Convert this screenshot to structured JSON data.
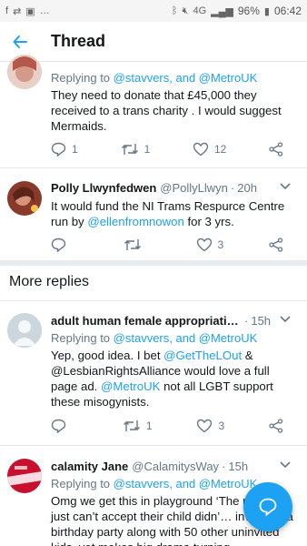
{
  "status_bar": {
    "battery": "96%",
    "time": "06:42",
    "network": "4G"
  },
  "header": {
    "title": "Thread"
  },
  "tweets": [
    {
      "reply_prefix": "Replying to ",
      "reply_targets": "@stavvers, and @MetroUK",
      "text": "They need to donate that £45,000 they received to a trans charity . I would suggest Mermaids.",
      "replies": "1",
      "retweets": "1",
      "likes": "12"
    },
    {
      "name": "Polly Llwynfedwen",
      "handle": "@PollyLlwyn",
      "time": "20h",
      "text_before": "It would fund the NI Trams Respurce Centre run by ",
      "text_link": "@ellenfromnowon",
      "text_after": " for 3 yrs.",
      "replies": "",
      "retweets": "",
      "likes": "3"
    },
    {
      "name": "adult human female appropriatin...",
      "time": "15h",
      "reply_prefix": "Replying to ",
      "reply_targets": "@stavvers, and @MetroUK",
      "text_1": "Yep, good idea. I bet ",
      "text_link_1": "@GetTheLOut",
      "text_2": " & @LesbianRightsAlliance would love a full page ad. ",
      "text_link_2": "@MetroUK",
      "text_3": " not all LGBT support these misogynists.",
      "replies": "",
      "retweets": "1",
      "likes": "3"
    },
    {
      "name": "calamity Jane",
      "handle": "@CalamitysWay",
      "time": "15h",
      "reply_prefix": "Replying to ",
      "reply_targets": "@stavvers, and @MetroUK",
      "text": "Omg we get this in playground ‘The p… who just can’t accept their child didn’… invited to a birthday party along with 50 other uninvited kids, yet makes big drama turning"
    }
  ],
  "sections": {
    "more_replies": "More replies"
  },
  "colors": {
    "accent": "#1da1f2",
    "muted": "#657786"
  }
}
